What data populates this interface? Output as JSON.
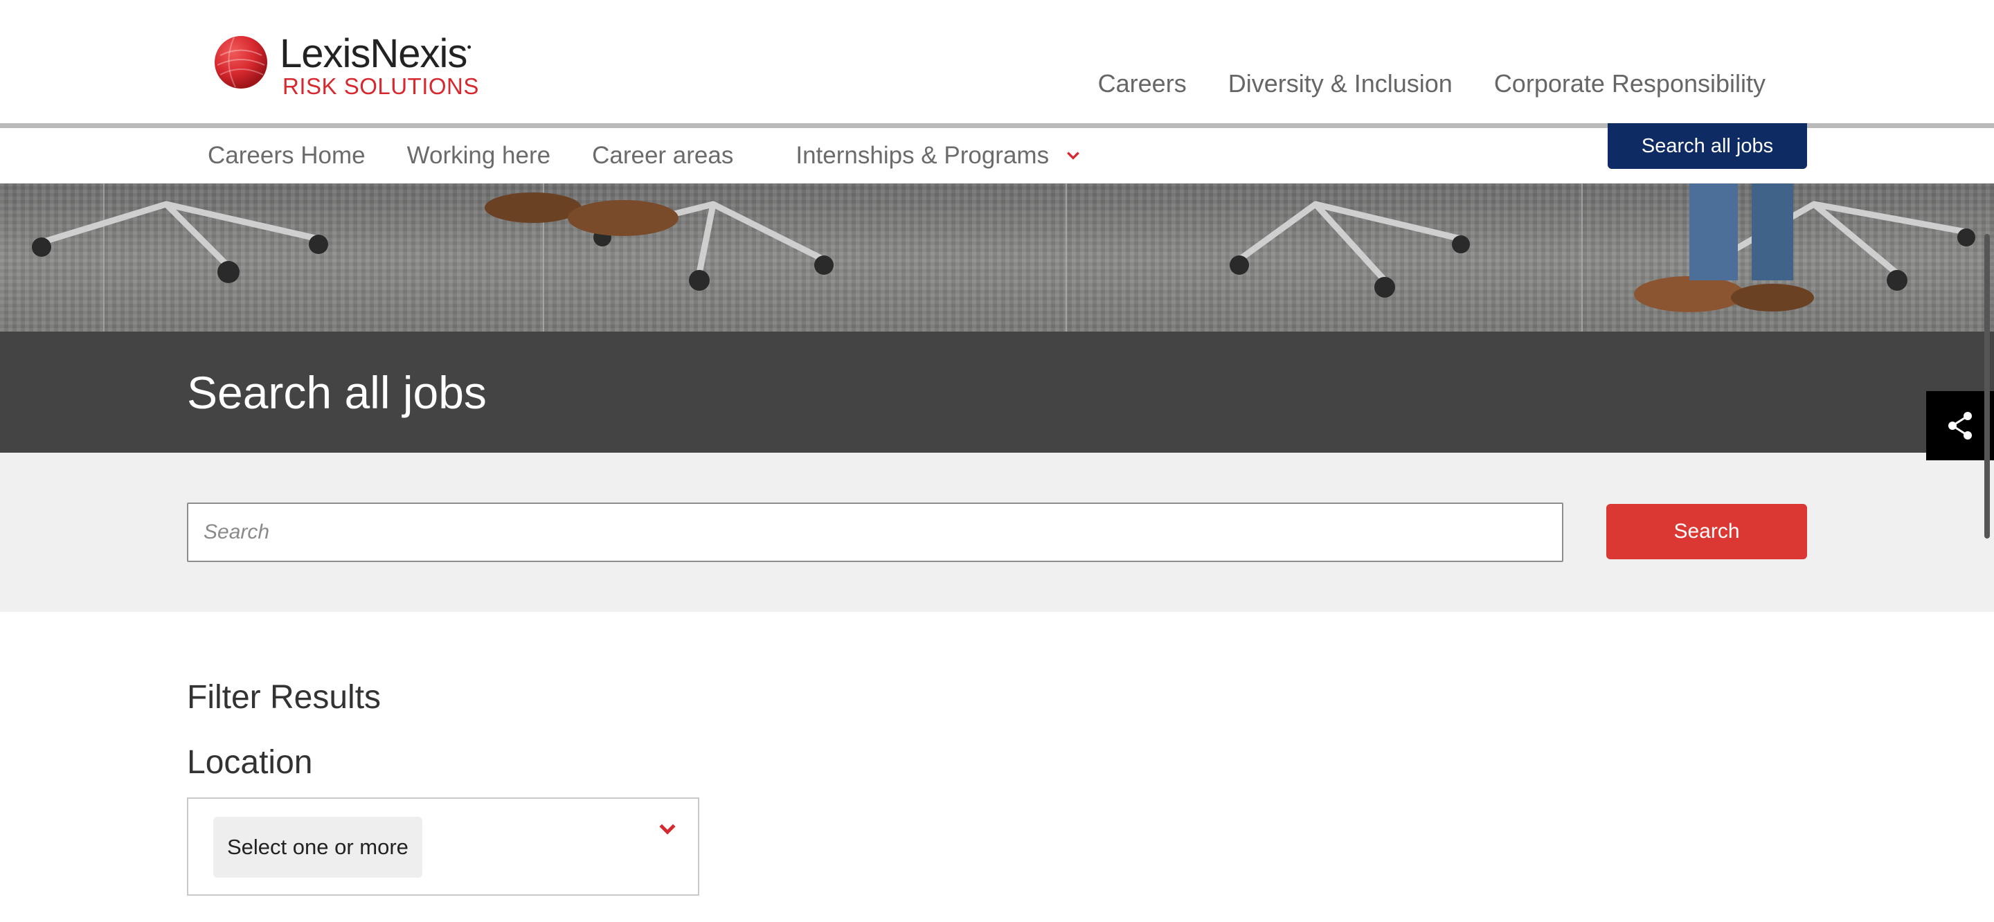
{
  "brand": {
    "name": "LexisNexis",
    "sub": "RISK SOLUTIONS",
    "accent": "#d6282e"
  },
  "top_nav": {
    "items": [
      "Careers",
      "Diversity & Inclusion",
      "Corporate Responsibility"
    ]
  },
  "sub_nav": {
    "items": [
      "Careers Home",
      "Working here",
      "Career areas",
      "Internships & Programs"
    ],
    "search_all_jobs": "Search all jobs"
  },
  "hero": {
    "icon": "office-floor-photo"
  },
  "title_band": {
    "title": "Search all jobs"
  },
  "search": {
    "placeholder": "Search",
    "value": "",
    "button": "Search",
    "button_color": "#dc3833"
  },
  "share": {
    "icon": "share-icon"
  },
  "filters": {
    "title": "Filter Results",
    "location_label": "Location",
    "location_placeholder": "Select one or more"
  }
}
